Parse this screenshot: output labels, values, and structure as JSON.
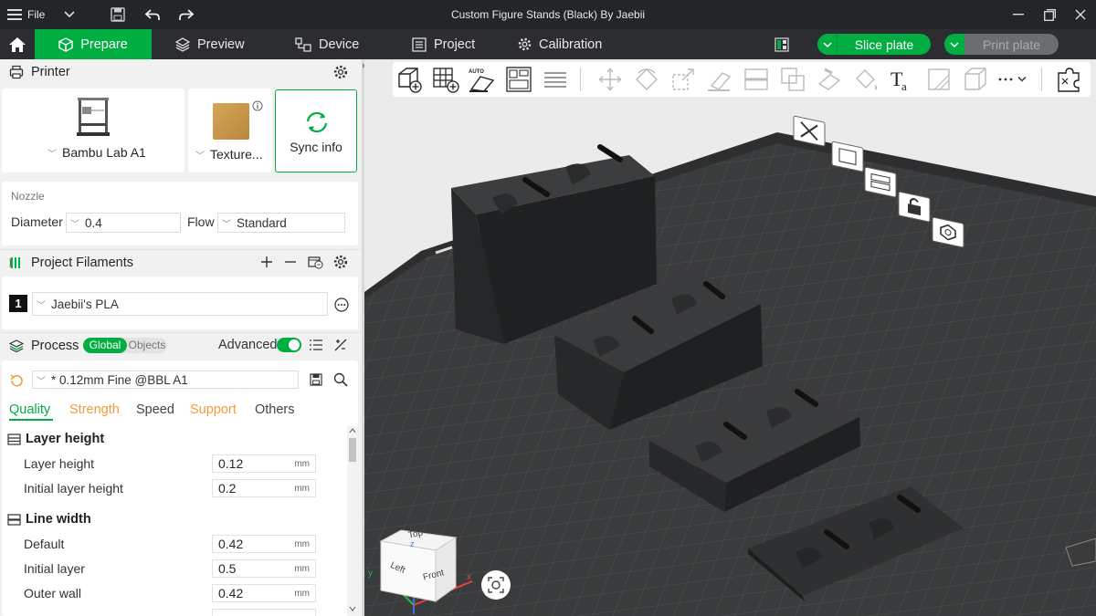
{
  "window": {
    "title": "Custom Figure Stands (Black) By Jaebii",
    "file_menu": "File"
  },
  "nav": {
    "tabs": [
      {
        "label": "Prepare"
      },
      {
        "label": "Preview"
      },
      {
        "label": "Device"
      },
      {
        "label": "Project"
      },
      {
        "label": "Calibration"
      }
    ],
    "slice_label": "Slice plate",
    "print_label": "Print plate"
  },
  "printer": {
    "header": "Printer",
    "name": "Bambu Lab A1",
    "plate": "Texture...",
    "sync_label": "Sync info",
    "nozzle_label": "Nozzle",
    "diameter_label": "Diameter",
    "diameter_value": "0.4",
    "flow_label": "Flow",
    "flow_value": "Standard"
  },
  "filaments": {
    "header": "Project Filaments",
    "items": [
      {
        "index": "1",
        "name": "Jaebii's PLA"
      }
    ]
  },
  "process": {
    "header": "Process",
    "mode_global": "Global",
    "mode_objects": "Objects",
    "advanced_label": "Advanced",
    "advanced_on": true,
    "preset": "* 0.12mm Fine @BBL A1",
    "tabs": [
      {
        "label": "Quality",
        "active": true
      },
      {
        "label": "Strength"
      },
      {
        "label": "Speed"
      },
      {
        "label": "Support"
      },
      {
        "label": "Others"
      }
    ],
    "groups": [
      {
        "title": "Layer height",
        "rows": [
          {
            "label": "Layer height",
            "value": "0.12",
            "unit": "mm"
          },
          {
            "label": "Initial layer height",
            "value": "0.2",
            "unit": "mm"
          }
        ]
      },
      {
        "title": "Line width",
        "rows": [
          {
            "label": "Default",
            "value": "0.42",
            "unit": "mm"
          },
          {
            "label": "Initial layer",
            "value": "0.5",
            "unit": "mm"
          },
          {
            "label": "Outer wall",
            "value": "0.42",
            "unit": "mm"
          }
        ]
      }
    ]
  },
  "viewport": {
    "cube_top": "Top",
    "cube_left": "Left",
    "cube_front": "Front",
    "axis_x": "x",
    "axis_y": "y",
    "axis_z": "z"
  },
  "colors": {
    "accent": "#00ae42",
    "topbar": "#232629",
    "navbar": "#2b2d31",
    "orange_tab": "#f39b3c"
  }
}
